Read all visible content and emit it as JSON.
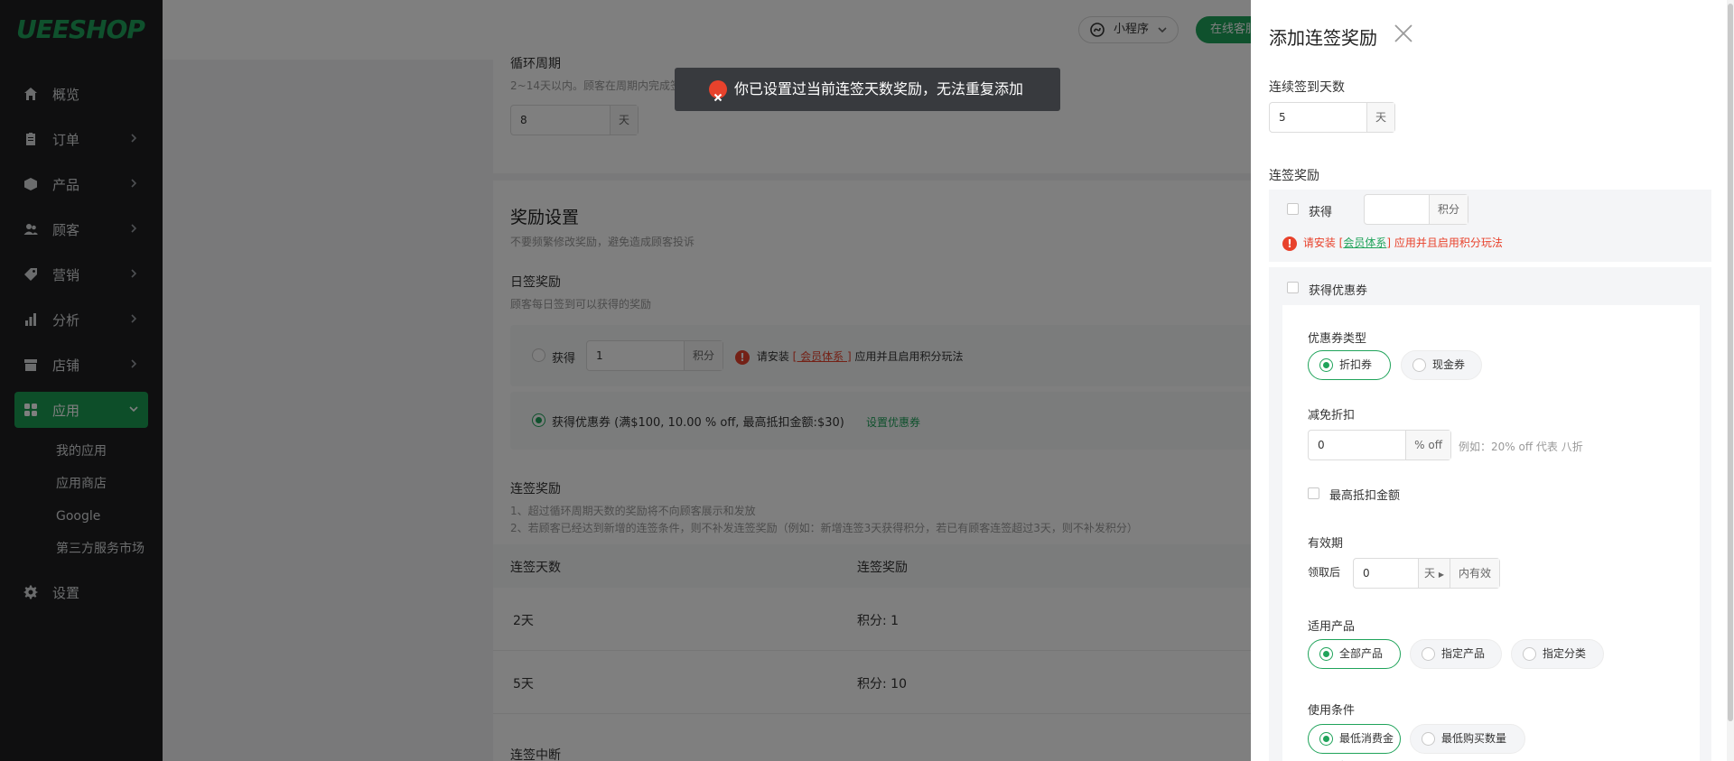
{
  "sidebar": {
    "logo": "UEESHOP",
    "items": [
      {
        "label": "概览",
        "icon": "home-icon"
      },
      {
        "label": "订单",
        "icon": "clipboard-icon"
      },
      {
        "label": "产品",
        "icon": "box-icon"
      },
      {
        "label": "顾客",
        "icon": "users-icon"
      },
      {
        "label": "营销",
        "icon": "tag-icon"
      },
      {
        "label": "分析",
        "icon": "bar-chart-icon"
      },
      {
        "label": "店铺",
        "icon": "store-icon"
      },
      {
        "label": "应用",
        "icon": "apps-icon"
      },
      {
        "label": "设置",
        "icon": "gear-icon"
      }
    ],
    "sub_items": [
      "我的应用",
      "应用商店",
      "Google",
      "第三方服务市场"
    ],
    "accent": "#1a9c52"
  },
  "topbar": {
    "mini_program": "小程序",
    "online_service": "在线客服"
  },
  "cycle": {
    "label": "循环周期",
    "hint": "2~14天以内。顾客在周期内完成签",
    "value": "8",
    "unit": "天"
  },
  "reward_settings": {
    "title": "奖励设置",
    "subtitle": "不要频繁修改奖励，避免造成顾客投诉",
    "daily": {
      "label": "日签奖励",
      "hint": "顾客每日签到可以获得的奖励",
      "obtain": "获得",
      "points_value": "1",
      "points_unit": "积分",
      "warn_prefix": "请安装",
      "warn_link": "[ 会员体系 ]",
      "warn_suffix": "应用并且启用积分玩法",
      "coupon_text": "获得优惠券 (满$100,  10.00 % off,  最高抵扣金额:$30)",
      "coupon_link": "设置优惠券"
    },
    "streak": {
      "label": "连签奖励",
      "note1": "1、超过循环周期天数的奖励将不向顾客展示和发放",
      "note2": "2、若顾客已经达到新增的连签条件，则不补发连签奖励（例如：新增连签3天获得积分，若已有顾客连签超过3天，则不补发积分）",
      "col_days": "连签天数",
      "col_reward": "连签奖励",
      "rows": [
        {
          "days": "2天",
          "reward": "积分:  1"
        },
        {
          "days": "5天",
          "reward": "积分:  10"
        }
      ]
    },
    "interrupt_label": "连签中断"
  },
  "toast": {
    "message": "你已设置过当前连签天数奖励，无法重复添加",
    "type": "error",
    "color": "#e8422c"
  },
  "drawer": {
    "title": "添加连签奖励",
    "days_label": "连续签到天数",
    "days_value": "5",
    "days_unit": "天",
    "reward_label": "连签奖励",
    "obtain": "获得",
    "points_value": "",
    "points_unit": "积分",
    "warn_prefix": "请安装",
    "warn_link_open": "[",
    "warn_link": "会员体系",
    "warn_link_close": "]",
    "warn_suffix": "应用并且启用积分玩法",
    "coupon_checkbox": "获得优惠券",
    "coupon_type_label": "优惠券类型",
    "coupon_types": [
      "折扣券",
      "现金券"
    ],
    "discount_label": "减免折扣",
    "discount_value": "0",
    "discount_unit": "% off",
    "discount_example": "例如：20% off 代表 八折",
    "max_deduct": "最高抵扣金额",
    "validity_label": "有效期",
    "validity_prefix": "领取后",
    "validity_value": "0",
    "validity_unit": "天",
    "validity_suffix": "内有效",
    "products_label": "适用产品",
    "products_options": [
      "全部产品",
      "指定产品",
      "指定分类"
    ],
    "conditions_label": "使用条件",
    "conditions_options": [
      "最低消费金额",
      "最低购买数量"
    ]
  }
}
